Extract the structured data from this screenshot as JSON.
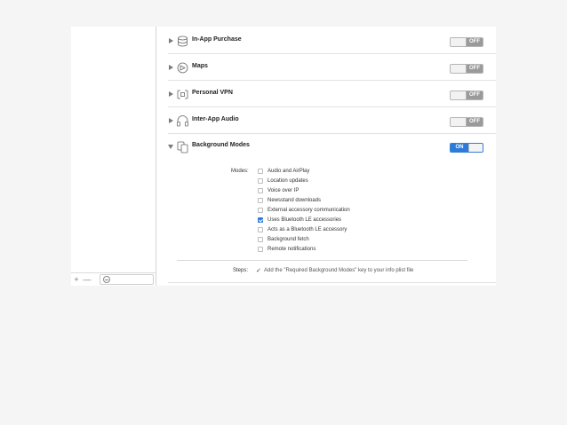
{
  "capabilities": [
    {
      "title": "In-App Purchase",
      "icon": "in-app-purchase-icon",
      "state": "OFF",
      "expanded": false
    },
    {
      "title": "Maps",
      "icon": "maps-icon",
      "state": "OFF",
      "expanded": false
    },
    {
      "title": "Personal VPN",
      "icon": "personal-vpn-icon",
      "state": "OFF",
      "expanded": false
    },
    {
      "title": "Inter-App Audio",
      "icon": "inter-app-audio-icon",
      "state": "OFF",
      "expanded": false
    },
    {
      "title": "Background Modes",
      "icon": "background-modes-icon",
      "state": "ON",
      "expanded": true
    }
  ],
  "background_modes": {
    "modes_label": "Modes:",
    "items": [
      {
        "label": "Audio and AirPlay",
        "checked": false
      },
      {
        "label": "Location updates",
        "checked": false
      },
      {
        "label": "Voice over IP",
        "checked": false
      },
      {
        "label": "Newsstand downloads",
        "checked": false
      },
      {
        "label": "External accessory communication",
        "checked": false
      },
      {
        "label": "Uses Bluetooth LE accessories",
        "checked": true
      },
      {
        "label": "Acts as a Bluetooth LE accessory",
        "checked": false
      },
      {
        "label": "Background fetch",
        "checked": false
      },
      {
        "label": "Remote notifications",
        "checked": false
      }
    ],
    "steps_label": "Steps:",
    "steps_text": "Add the \"Required Background Modes\" key to your info plist file"
  },
  "sidebar": {
    "add_label": "+",
    "remove_label": "—"
  },
  "colors": {
    "accent": "#2d7bd9",
    "off_state": "#9a9a9a"
  }
}
